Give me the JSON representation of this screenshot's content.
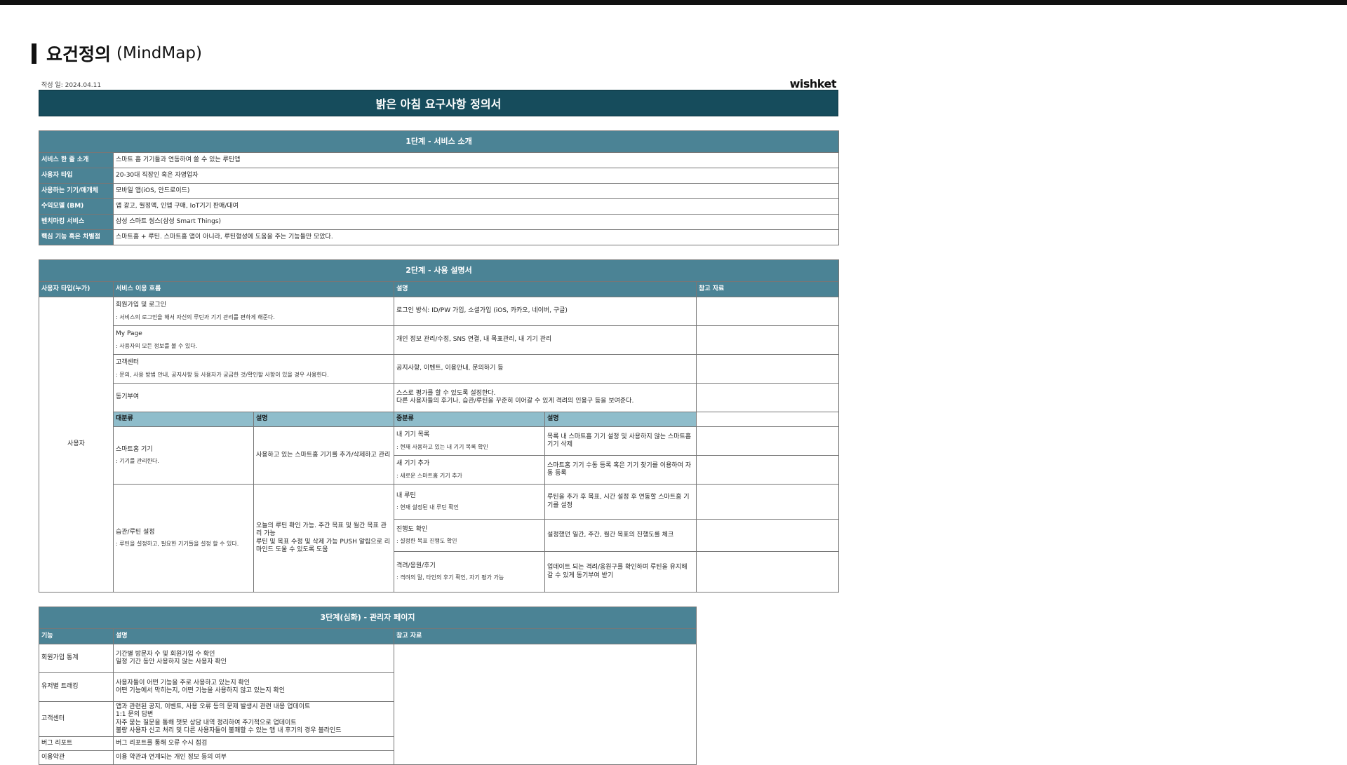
{
  "slide": {
    "title": "요건정의",
    "subtitle": "(MindMap)"
  },
  "doc": {
    "date": "작성 일: 2024.04.11",
    "logo": "wishket",
    "title": "밝은 아침 요구사항 정의서"
  },
  "stage1": {
    "title": "1단계 - 서비스 소개",
    "rows": [
      {
        "label": "서비스 한 줄 소개",
        "value": "스마트 홈 기기들과 연동하여 쓸 수 있는 루틴앱"
      },
      {
        "label": "사용자 타입",
        "value": "20-30대 직장인 혹은 자영업자"
      },
      {
        "label": "사용하는 기기/매개체",
        "value": "모바일 앱(iOS, 안드로이드)"
      },
      {
        "label": "수익모델 (BM)",
        "value": "앱 광고, 월정액, 인앱 구매, IoT기기 판매/대여"
      },
      {
        "label": "벤치마킹 서비스",
        "value": "삼성 스마트 씽스(삼성 Smart Things)"
      },
      {
        "label": "핵심 기능 혹은 차별점",
        "value": "스마트홈 + 루틴. 스마트홈 앱이 아니라, 루틴형성에 도움을 주는 기능들만 모았다."
      }
    ]
  },
  "stage2": {
    "title": "2단계 - 사용 설명서",
    "headers": {
      "user_type": "사용자 타입(누가)",
      "flow": "서비스 이용 흐름",
      "desc": "설명",
      "ref": "참고 자료"
    },
    "user": "사용자",
    "flows": [
      {
        "name": "회원가입 및 로그인",
        "sub": ": 서비스의 로그인을 해서 자신의 루틴과 기기 관리를 편하게 해준다.",
        "desc": "로그인 방식: ID/PW 가입, 소셜가입 (iOS, 카카오, 네이버, 구글)"
      },
      {
        "name": "My Page",
        "sub": ": 사용자의 모든 정보를 볼 수 있다.",
        "desc": "개인 정보 관리/수정, SNS 연결, 내 목표관리, 내 기기 관리"
      },
      {
        "name": "고객센터",
        "sub": ": 문의, 사용 방법 안내, 공지사항 등 사용자가 궁금한 것/확인할 사항이 있을 경우 사용한다.",
        "desc": "공지사항, 이벤트, 이용안내, 문의하기 등"
      },
      {
        "name": "동기부여",
        "sub": "",
        "desc": "스스로 평가를 할 수 있도록 설정한다.\n다른 사용자들의 후기나, 습관/루틴을 꾸준히 이어갈 수 있게 격려의 인용구 등을 보여준다."
      }
    ],
    "sub_headers": {
      "major": "대분류",
      "major_desc": "설명",
      "middle": "중분류",
      "middle_desc": "설명"
    },
    "groups": [
      {
        "name": "스마트홈 기기",
        "sub": ": 기기를 관리한다.",
        "desc": "사용하고 있는 스마트홈 기기를 추가/삭제하고 관리",
        "items": [
          {
            "name": "내 기기 목록",
            "sub": ": 현재 사용하고 있는 내 기기 목록 확인",
            "desc": "목록 내 스마트홈 기기 설정 및 사용하지 않는 스마트홈 기기 삭제"
          },
          {
            "name": "새 기기 추가",
            "sub": ": 새로운 스마트홈 기기 추가",
            "desc": "스마트홈 기기 수동 등록 혹은 기기 찾기를 이용하여 자동 등록"
          }
        ]
      },
      {
        "name": "습관/루틴 설정",
        "sub": ": 루틴을 설정하고, 필요한 기기들을 설정 할 수 있다.",
        "desc": "오늘의 루틴 확인 가능. 주간 목표 및 월간 목표 관리 가능\n루틴 및 목표 수정 및 삭제 가능 PUSH 알림으로 리마인드 도울 수 있도록 도움",
        "items": [
          {
            "name": "내 루틴",
            "sub": ": 현재 설정된 내 루틴 확인",
            "desc": "루틴을 추가 후 목표, 시간 설정 후 연동할 스마트홈 기기를 설정"
          },
          {
            "name": "진행도 확인",
            "sub": ": 설정한 목표 진행도 확인",
            "desc": "설정했던 일간, 주간, 월간 목표의 진행도를 체크"
          },
          {
            "name": "격려/응원/후기",
            "sub": ": 격려의 말, 타인의 후기 확인, 자기 평가 가능",
            "desc": "업데이트 되는 격려/응원구를 확인하며 루틴을 유지해 갈 수 있게 동기부여 받기"
          }
        ]
      }
    ]
  },
  "stage3": {
    "title": "3단계(심화) - 관리자 페이지",
    "headers": {
      "feature": "기능",
      "desc": "설명",
      "ref": "참고 자료"
    },
    "rows": [
      {
        "feature": "회원가입 통계",
        "desc": "기간별 방문자 수 및 회원가입 수 확인\n일정 기간 동안 사용하지 않는 사용자 확인"
      },
      {
        "feature": "유저별 트래킹",
        "desc": "사용자들이 어떤 기능을 주로 사용하고 있는지 확인\n어떤 기능에서 막히는지, 어떤 기능을 사용하지 않고 있는지 확인"
      },
      {
        "feature": "고객센터",
        "desc": "앱과 관련된 공지, 이벤트, 사용 오류 등의 문제 발생시 관련 내용 업데이트\n1:1 문의 답변\n자주 묻는 질문을 통해 챗봇 상담 내역 정리하여 주기적으로 업데이트\n불량 사용자 신고 처리 및 다른 사용자들이 불쾌할 수 있는 앱 내 후기의 경우 블라인드"
      },
      {
        "feature": "버그 리포트",
        "desc": "버그 리포트를 통해 오류 수시 점검"
      },
      {
        "feature": "이용약관",
        "desc": "이용 약관과 연계되는 개인 정보 등의 여부"
      }
    ]
  }
}
